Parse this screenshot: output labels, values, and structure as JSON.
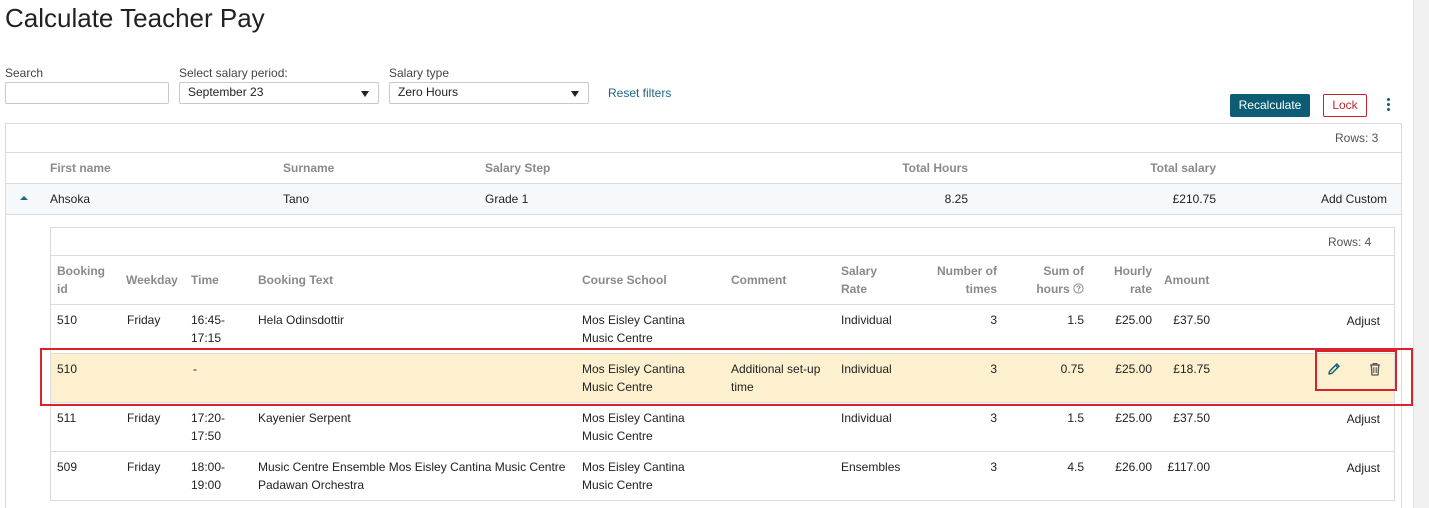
{
  "page": {
    "title": "Calculate Teacher Pay"
  },
  "filters": {
    "search_label": "Search",
    "search_value": "",
    "period_label": "Select salary period:",
    "period_value": "September 23",
    "type_label": "Salary type",
    "type_value": "Zero Hours",
    "reset_label": "Reset filters"
  },
  "toolbar": {
    "recalculate_label": "Recalculate",
    "lock_label": "Lock",
    "more_icon": "kebab-vertical-icon"
  },
  "colors": {
    "primary": "#0c5c74",
    "link": "#1e6489",
    "danger": "#c0262d",
    "highlight": "#fdf0cf"
  },
  "outer_table": {
    "rows_label": "Rows: 3",
    "headers": [
      "First name",
      "Surname",
      "Salary Step",
      "Total Hours",
      "Total salary"
    ],
    "rows": [
      {
        "first_name": "Ahsoka",
        "surname": "Tano",
        "salary_step": "Grade 1",
        "total_hours": "8.25",
        "total_salary": "£210.75",
        "action": "Add Custom",
        "expanded": true
      }
    ]
  },
  "inner_table": {
    "rows_label": "Rows: 4",
    "headers": {
      "booking_id_1": "Booking",
      "booking_id_2": "id",
      "weekday": "Weekday",
      "time": "Time",
      "booking_text": "Booking Text",
      "course_school": "Course School",
      "comment": "Comment",
      "salary_rate_1": "Salary",
      "salary_rate_2": "Rate",
      "times_1": "Number of",
      "times_2": "times",
      "sum_hours_1": "Sum of",
      "sum_hours_2": "hours",
      "hourly_1": "Hourly",
      "hourly_2": "rate",
      "amount": "Amount"
    },
    "rows": [
      {
        "id": "510",
        "weekday": "Friday",
        "time1": "16:45-",
        "time2": "17:15",
        "text1": "Hela Odinsdottir",
        "text2": "",
        "school1": "Mos Eisley Cantina",
        "school2": "Music Centre",
        "comment1": "",
        "comment2": "",
        "rate": "Individual",
        "times": "3",
        "hours": "1.5",
        "hourly": "£25.00",
        "amount": "£37.50",
        "action": "Adjust"
      },
      {
        "id": "510",
        "weekday": "",
        "time1": "-",
        "time2": "",
        "text1": "",
        "text2": "",
        "school1": "Mos Eisley Cantina",
        "school2": "Music Centre",
        "comment1": "Additional set-up",
        "comment2": "time",
        "rate": "Individual",
        "times": "3",
        "hours": "0.75",
        "hourly": "£25.00",
        "amount": "£18.75",
        "action": ""
      },
      {
        "id": "511",
        "weekday": "Friday",
        "time1": "17:20-",
        "time2": "17:50",
        "text1": "Kayenier Serpent",
        "text2": "",
        "school1": "Mos Eisley Cantina",
        "school2": "Music Centre",
        "comment1": "",
        "comment2": "",
        "rate": "Individual",
        "times": "3",
        "hours": "1.5",
        "hourly": "£25.00",
        "amount": "£37.50",
        "action": "Adjust"
      },
      {
        "id": "509",
        "weekday": "Friday",
        "time1": "18:00-",
        "time2": "19:00",
        "text1": "Music Centre Ensemble Mos Eisley Cantina Music Centre",
        "text2": "Padawan Orchestra",
        "school1": "Mos Eisley Cantina",
        "school2": "Music Centre",
        "comment1": "",
        "comment2": "",
        "rate": "Ensembles",
        "times": "3",
        "hours": "4.5",
        "hourly": "£26.00",
        "amount": "£117.00",
        "action": "Adjust"
      }
    ]
  }
}
